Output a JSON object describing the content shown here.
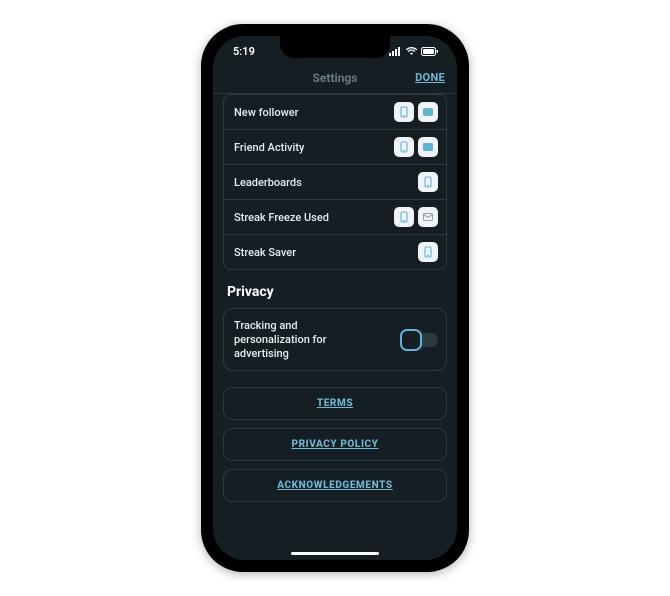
{
  "status": {
    "time": "5:19"
  },
  "nav": {
    "title": "Settings",
    "done": "DONE"
  },
  "notif_rows": [
    {
      "label": "New follower",
      "push": true,
      "email": true,
      "show_email": true
    },
    {
      "label": "Friend Activity",
      "push": true,
      "email": true,
      "show_email": true
    },
    {
      "label": "Leaderboards",
      "push": true,
      "email": false,
      "show_email": false
    },
    {
      "label": "Streak Freeze Used",
      "push": true,
      "email": false,
      "show_email": true
    },
    {
      "label": "Streak Saver",
      "push": true,
      "email": false,
      "show_email": false
    }
  ],
  "privacy": {
    "heading": "Privacy",
    "tracking_label": "Tracking and personalization for advertising",
    "tracking_on": false
  },
  "links": {
    "terms": "TERMS",
    "privacy_policy": "PRIVACY POLICY",
    "ack": "ACKNOWLEDGEMENTS"
  }
}
